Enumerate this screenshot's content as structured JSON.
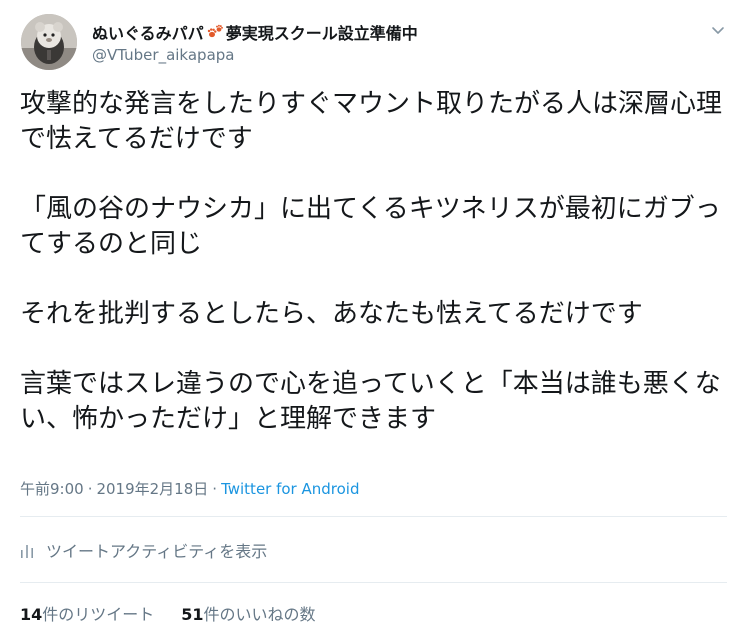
{
  "user": {
    "display_name": "ぬいぐるみパパ",
    "display_name_suffix": "夢実現スクール設立準備中",
    "handle": "@VTuber_aikapapa",
    "avatar_icon": "plush-toy-avatar",
    "name_emoji_icon": "paw-prints-icon"
  },
  "tweet": {
    "paragraphs": [
      "攻撃的な発言をしたりすぐマウント取りたがる人は深層心理で怯えてるだけです",
      "「風の谷のナウシカ」に出てくるキツネリスが最初にガブってするのと同じ",
      "それを批判するとしたら、あなたも怯えてるだけです",
      "言葉ではスレ違うので心を追っていくと「本当は誰も悪くない、怖かっただけ」と理解できます"
    ]
  },
  "meta": {
    "time": "午前9:00",
    "separator": "·",
    "date": "2019年2月18日",
    "source": "Twitter for Android"
  },
  "activity": {
    "icon": "bar-chart-icon",
    "label": "ツイートアクティビティを表示"
  },
  "stats": {
    "retweets_count": "14",
    "retweets_label": "件のリツイート",
    "likes_count": "51",
    "likes_label": "件のいいねの数"
  },
  "colors": {
    "text_primary": "#14171a",
    "text_secondary": "#657786",
    "link": "#1b95e0",
    "divider": "#e6ecf0",
    "paw_emoji": "#e25a2b"
  }
}
